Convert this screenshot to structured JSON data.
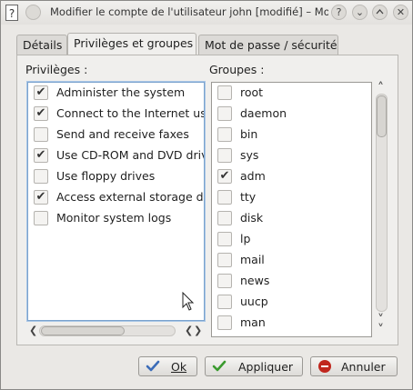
{
  "window": {
    "title": "Modifier le compte de l'utilisateur john [modifié] – Mo...",
    "help_glyph": "?",
    "shade_glyph": "⌄",
    "close_glyph": "✕"
  },
  "tabs": [
    {
      "label": "Détails",
      "active": false
    },
    {
      "label": "Privilèges et groupes",
      "active": true
    },
    {
      "label": "Mot de passe / sécurité",
      "active": false
    }
  ],
  "privileges": {
    "heading": "Privilèges :",
    "items": [
      {
        "label": "Administer the system",
        "checked": true
      },
      {
        "label": "Connect to the Internet us",
        "checked": true
      },
      {
        "label": "Send and receive faxes",
        "checked": false
      },
      {
        "label": "Use CD-ROM and DVD drive",
        "checked": true
      },
      {
        "label": "Use floppy drives",
        "checked": false
      },
      {
        "label": "Access external storage de",
        "checked": true
      },
      {
        "label": "Monitor system logs",
        "checked": false
      }
    ]
  },
  "groups": {
    "heading": "Groupes :",
    "items": [
      {
        "label": "root",
        "checked": false
      },
      {
        "label": "daemon",
        "checked": false
      },
      {
        "label": "bin",
        "checked": false
      },
      {
        "label": "sys",
        "checked": false
      },
      {
        "label": "adm",
        "checked": true
      },
      {
        "label": "tty",
        "checked": false
      },
      {
        "label": "disk",
        "checked": false
      },
      {
        "label": "lp",
        "checked": false
      },
      {
        "label": "mail",
        "checked": false
      },
      {
        "label": "news",
        "checked": false
      },
      {
        "label": "uucp",
        "checked": false
      },
      {
        "label": "man",
        "checked": false
      }
    ]
  },
  "buttons": {
    "ok": "Ok",
    "apply": "Appliquer",
    "cancel": "Annuler"
  },
  "glyphs": {
    "check": "✔",
    "left": "❮",
    "right": "❯",
    "up": "˄",
    "down": "˅"
  },
  "colors": {
    "focus_border": "#7ba3cd",
    "ok_check": "#3b6cb8",
    "apply_check": "#3a9a2e",
    "cancel_icon": "#c0261d"
  }
}
